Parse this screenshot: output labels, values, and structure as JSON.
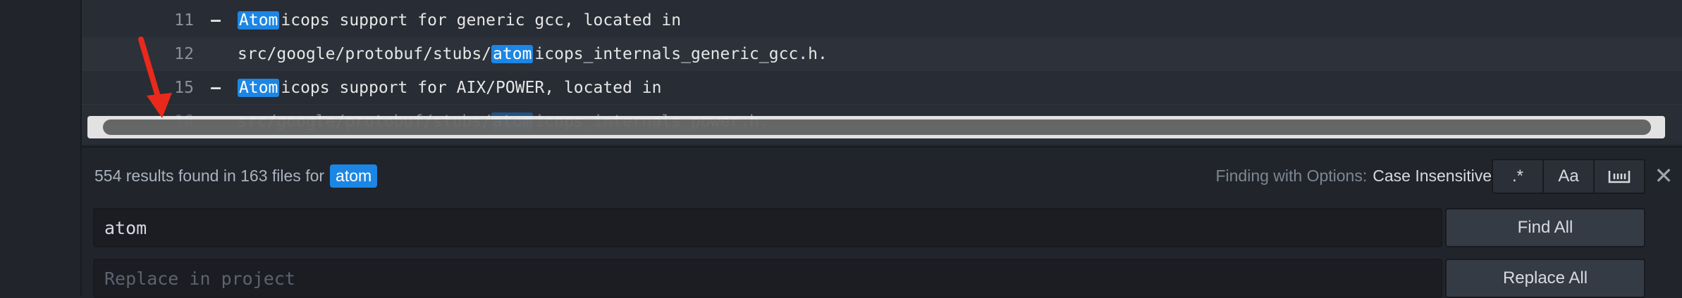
{
  "results": {
    "rows": [
      {
        "line": "11",
        "marker": "–",
        "match": "Atom",
        "rest": "icops support for generic gcc, located in"
      },
      {
        "line": "12",
        "marker": "",
        "prefix": "src/google/protobuf/stubs/",
        "match": "atom",
        "rest": "icops_internals_generic_gcc.h."
      },
      {
        "line": "15",
        "marker": "–",
        "match": "Atom",
        "rest": "icops support for AIX/POWER, located in"
      },
      {
        "line": "16",
        "marker": "",
        "prefix": "src/google/protobuf/stubs/",
        "match": "atom",
        "rest": "icops_internals_power.h."
      }
    ]
  },
  "panel": {
    "summary_text": "554 results found in 163 files for",
    "summary_term": "atom",
    "options_label": "Finding with Options:",
    "options_value": "Case Insensitive",
    "regex_icon": ".*",
    "case_icon": "Aa",
    "find_value": "atom",
    "replace_placeholder": "Replace in project",
    "find_all_label": "Find All",
    "replace_all_label": "Replace All"
  },
  "colors": {
    "accent": "#1c86e4",
    "arrow": "#e8291c"
  }
}
